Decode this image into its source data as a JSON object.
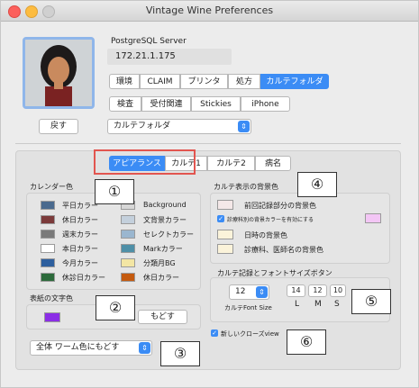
{
  "window": {
    "title": "Vintage Wine Preferences"
  },
  "server": {
    "label": "PostgreSQL Server",
    "address": "172.21.1.175"
  },
  "tabs_top": [
    {
      "label": "環境"
    },
    {
      "label": "CLAIM"
    },
    {
      "label": "プリンタ"
    },
    {
      "label": "処方"
    },
    {
      "label": "カルテフォルダ"
    }
  ],
  "tabs_second": [
    {
      "label": "検査"
    },
    {
      "label": "受付関連"
    },
    {
      "label": "Stickies"
    },
    {
      "label": "iPhone"
    }
  ],
  "back_button": "戻す",
  "folder_select": "カルテフォルダ",
  "subtabs": [
    {
      "label": "アピアランス"
    },
    {
      "label": "カルテ1"
    },
    {
      "label": "カルテ2"
    },
    {
      "label": "病名"
    }
  ],
  "calendar": {
    "title": "カレンダー色",
    "left_items": [
      {
        "label": "平日カラー",
        "color": "#4a6a8e"
      },
      {
        "label": "休日カラー",
        "color": "#7b3a3a"
      },
      {
        "label": "週末カラー",
        "color": "#7a7a7a"
      },
      {
        "label": "本日カラー",
        "color": "#ffffff"
      },
      {
        "label": "今月カラー",
        "color": "#2d5f9e"
      },
      {
        "label": "休診日カラー",
        "color": "#2c6a3b"
      }
    ],
    "right_items": [
      {
        "label": "Background",
        "color": "#d7d7d7"
      },
      {
        "label": "文背景カラー",
        "color": "#c4d0dc"
      },
      {
        "label": "セレクトカラー",
        "color": "#9ab6cf"
      },
      {
        "label": "Markカラー",
        "color": "#4e8fa7"
      },
      {
        "label": "分類月BG",
        "color": "#f3e6a4"
      },
      {
        "label": "休日カラー",
        "color": "#c45a0f"
      }
    ]
  },
  "cover": {
    "title": "表紙の文字色",
    "color": "#8b2ee6",
    "reset_button": "もどす"
  },
  "bottom_select": "全体 ワーム色にもどす",
  "karte_bg": {
    "title": "カルテ表示の背景色",
    "items": [
      {
        "label": "前回記録部分の背景色",
        "color": "#f4e8e8"
      },
      {
        "label": "日時の背景色",
        "color": "#fbf3da"
      },
      {
        "label": "診療科、医師名の背景色",
        "color": "#fbf3da"
      }
    ],
    "checkbox_label": "診療科別の背景カラーを有効にする",
    "checkbox_swatch": "#f3c6f5"
  },
  "font_size": {
    "title": "カルテ記録とフォントサイズボタン",
    "value": "12",
    "caption": "カルテFont Size",
    "sizes": [
      "14",
      "12",
      "10"
    ],
    "size_labels": [
      "L",
      "M",
      "S"
    ]
  },
  "close_view": {
    "label": "新しいクローズview"
  },
  "callouts": [
    "①",
    "②",
    "③",
    "④",
    "⑤",
    "⑥"
  ]
}
